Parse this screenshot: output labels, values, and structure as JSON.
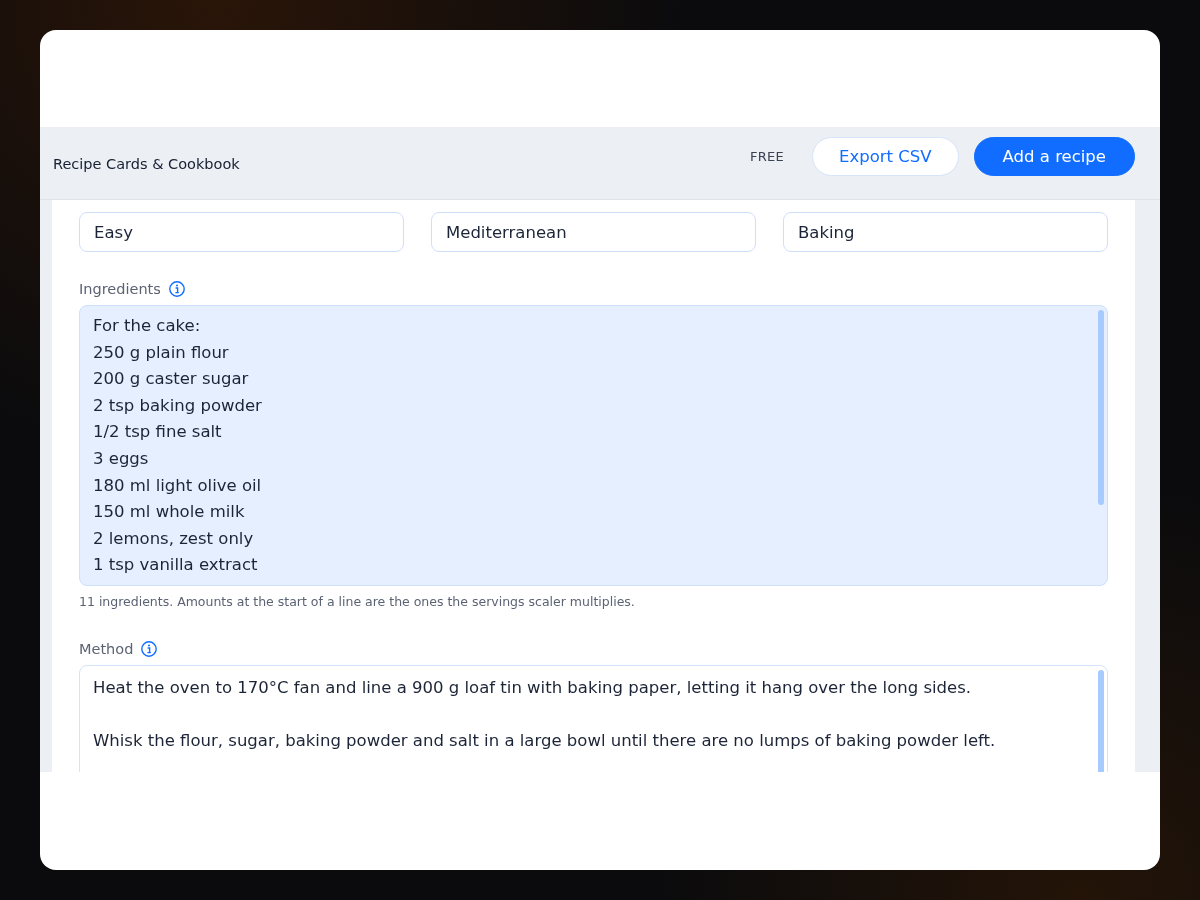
{
  "header": {
    "title": "Recipe Cards & Cookbook",
    "plan": "FREE",
    "buttons": [
      {
        "label": "Export CSV",
        "kind": "secondary"
      },
      {
        "label": "Add a recipe",
        "kind": "primary"
      }
    ]
  },
  "fields": [
    {
      "value": "Easy"
    },
    {
      "value": "Mediterranean"
    },
    {
      "value": "Baking"
    }
  ],
  "ingredients": {
    "label": "Ingredients",
    "focused": true,
    "lines": [
      "For the cake:",
      "250 g plain flour",
      "200 g caster sugar",
      "2 tsp baking powder",
      "1/2 tsp fine salt",
      "3 eggs",
      "180 ml light olive oil",
      "150 ml whole milk",
      "2 lemons, zest only",
      "1 tsp vanilla extract"
    ],
    "helper": "11 ingredients. Amounts at the start of a line are the ones the servings scaler multiplies."
  },
  "method": {
    "label": "Method",
    "focused": false,
    "paragraphs": [
      "Heat the oven to 170°C fan and line a 900 g loaf tin with baking paper, letting it hang over the long sides.",
      "Whisk the flour, sugar, baking powder and salt in a large bowl until there are no lumps of baking powder left."
    ]
  }
}
